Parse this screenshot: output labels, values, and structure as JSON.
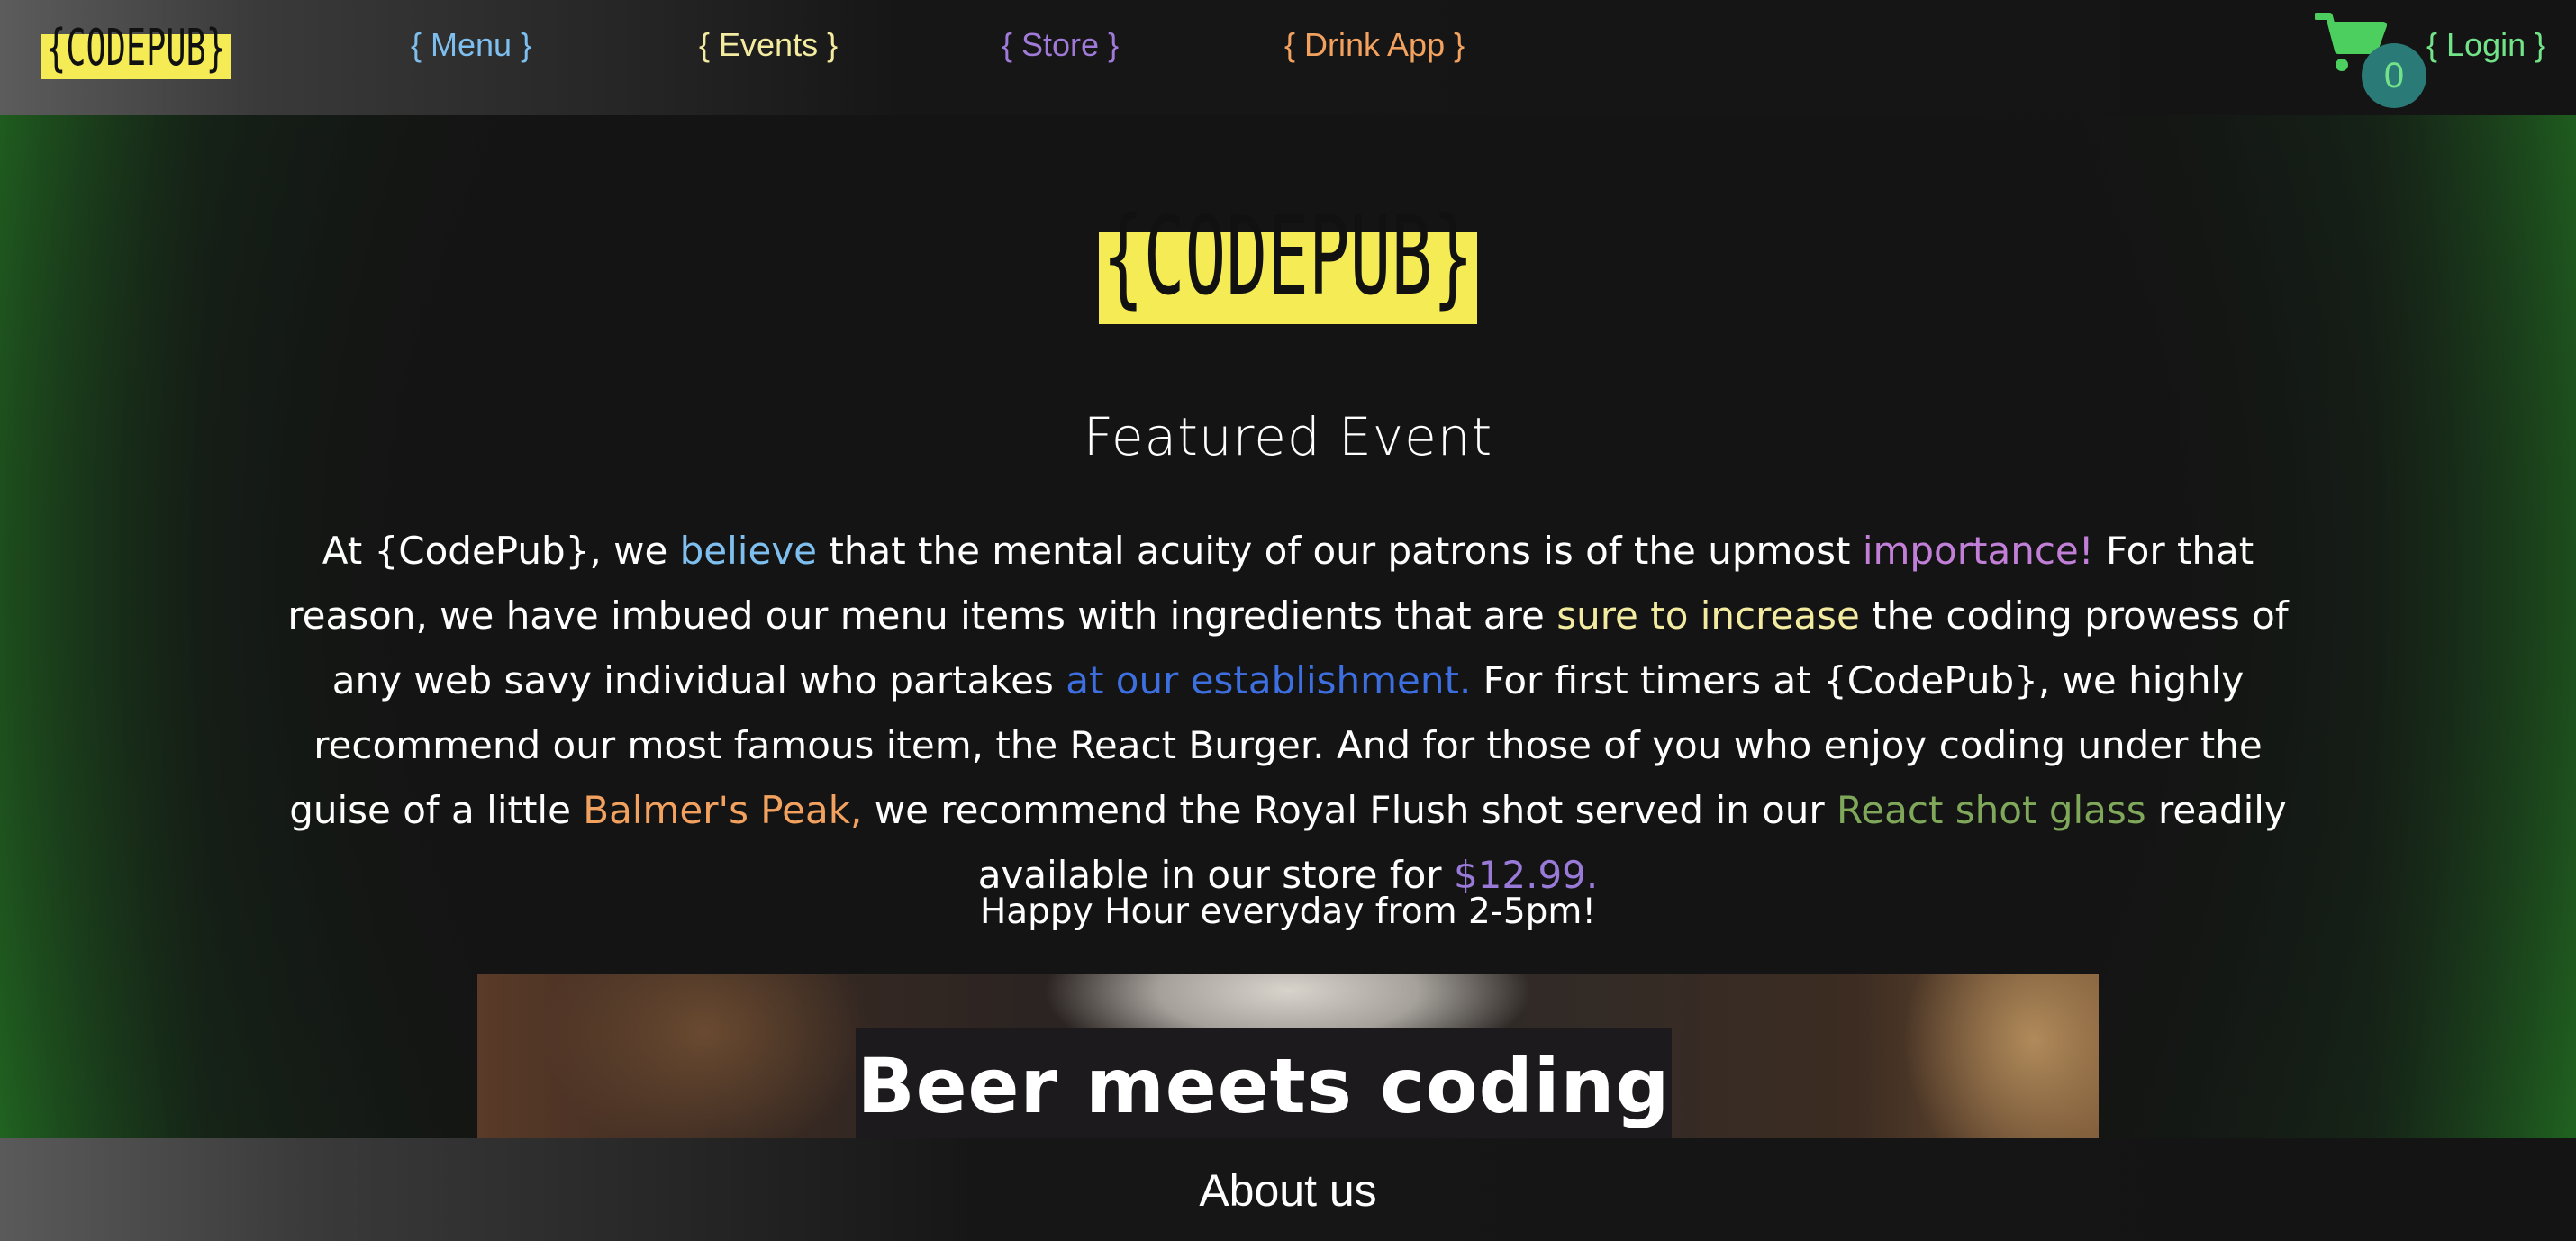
{
  "brand": {
    "logo_text": "{CODEPUB}",
    "logo_bg": "#f5ec55",
    "logo_fg": "#111111"
  },
  "nav": {
    "links": [
      {
        "label": "{ Menu }",
        "color": "#7fbfef"
      },
      {
        "label": "{ Events }",
        "color": "#f3eba0"
      },
      {
        "label": "{ Store }",
        "color": "#a07ad8"
      },
      {
        "label": "{ Drink App }",
        "color": "#f2a15f"
      }
    ],
    "login": {
      "label": "{ Login }",
      "color": "#73e38a"
    },
    "cart": {
      "icon": "shopping-cart-icon",
      "count": "0",
      "color": "#4ccf5e"
    }
  },
  "main": {
    "title": "Featured Event",
    "paragraph": [
      {
        "text": "At {CodePub}, we ",
        "color": "#ffffff"
      },
      {
        "text": "believe",
        "color": "#7fbfef"
      },
      {
        "text": " that the mental acuity of our patrons is of the upmost ",
        "color": "#ffffff"
      },
      {
        "text": "importance!",
        "color": "#c27fd8"
      },
      {
        "text": " For that reason, we have imbued our menu items with ingredients that are ",
        "color": "#ffffff"
      },
      {
        "text": "sure to increase",
        "color": "#f3eba0"
      },
      {
        "text": " the coding prowess of any web savy individual who partakes ",
        "color": "#ffffff"
      },
      {
        "text": "at our establishment.",
        "color": "#3d6fe0"
      },
      {
        "text": " For first timers at {CodePub}, we highly recommend our most famous item, the React Burger. And for those of you who enjoy coding under the guise of a little ",
        "color": "#ffffff"
      },
      {
        "text": "Balmer's Peak,",
        "color": "#f2a15f"
      },
      {
        "text": " we recommend the Royal Flush shot served in our ",
        "color": "#ffffff"
      },
      {
        "text": "React shot glass",
        "color": "#7fa85a"
      },
      {
        "text": " readily available in our store for ",
        "color": "#ffffff"
      },
      {
        "text": "$12.99.",
        "color": "#9a7ad8"
      }
    ],
    "happy_hour": "Happy Hour everyday from 2-5pm!",
    "banner_caption": "Beer meets coding"
  },
  "footer": {
    "title": "About us"
  }
}
